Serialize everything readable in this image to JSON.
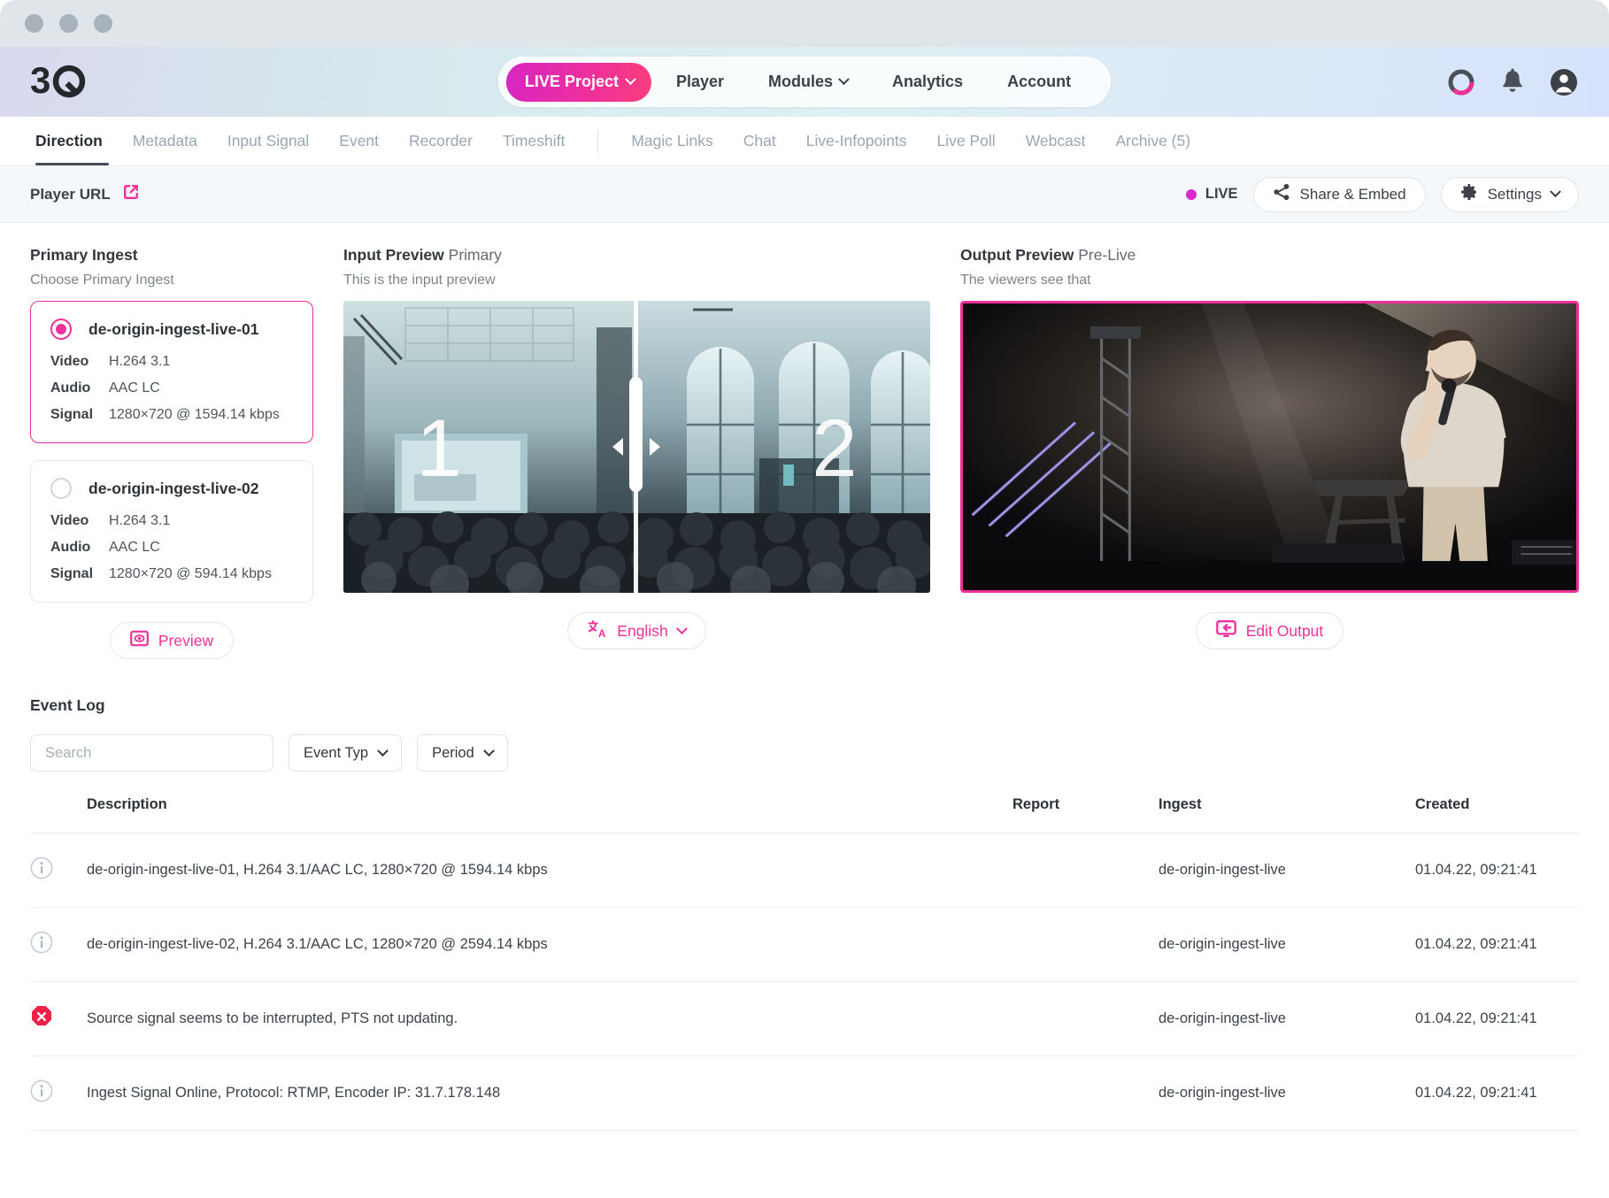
{
  "colors": {
    "accent": "#f0309a",
    "live": "#d92ad0",
    "error": "#ee2048",
    "text": "#3b4146"
  },
  "header": {
    "logo_text": "3Q",
    "project_button": "LIVE Project",
    "nav": [
      {
        "label": "Player",
        "caret": false
      },
      {
        "label": "Modules",
        "caret": true
      },
      {
        "label": "Analytics",
        "caret": false
      },
      {
        "label": "Account",
        "caret": false
      }
    ],
    "icons": [
      "ring-progress-icon",
      "bell-icon",
      "account-avatar-icon"
    ]
  },
  "tabs": [
    {
      "label": "Direction",
      "active": true
    },
    {
      "label": "Metadata",
      "active": false
    },
    {
      "label": "Input Signal",
      "active": false
    },
    {
      "label": "Event",
      "active": false
    },
    {
      "label": "Recorder",
      "active": false
    },
    {
      "label": "Timeshift",
      "active": false
    }
  ],
  "tabs2": [
    {
      "label": "Magic Links"
    },
    {
      "label": "Chat"
    },
    {
      "label": "Live-Infopoints"
    },
    {
      "label": "Live Poll"
    },
    {
      "label": "Webcast"
    },
    {
      "label": "Archive (5)"
    }
  ],
  "toolbar": {
    "player_url": "Player URL",
    "live_label": "LIVE",
    "share_label": "Share & Embed",
    "settings_label": "Settings"
  },
  "primary_ingest": {
    "title": "Primary Ingest",
    "subtitle": "Choose Primary Ingest",
    "preview_button": "Preview",
    "items": [
      {
        "name": "de-origin-ingest-live-01",
        "selected": true,
        "video_key": "Video",
        "video": "H.264 3.1",
        "audio_key": "Audio",
        "audio": "AAC LC",
        "signal_key": "Signal",
        "signal": "1280×720 @ 1594.14 kbps"
      },
      {
        "name": "de-origin-ingest-live-02",
        "selected": false,
        "video_key": "Video",
        "video": "H.264 3.1",
        "audio_key": "Audio",
        "audio": "AAC LC",
        "signal_key": "Signal",
        "signal": "1280×720 @ 594.14 kbps"
      }
    ]
  },
  "input_preview": {
    "title": "Input Preview",
    "badge": "Primary",
    "subtitle": "This is the input preview",
    "overlay_left": "1",
    "overlay_right": "2",
    "language_button": "English"
  },
  "output_preview": {
    "title": "Output Preview",
    "badge": "Pre-Live",
    "subtitle": "The viewers see that",
    "edit_button": "Edit Output"
  },
  "event_log": {
    "title": "Event Log",
    "search_placeholder": "Search",
    "search_value": "",
    "event_type_label": "Event Typ",
    "period_label": "Period",
    "columns": [
      "Description",
      "Report",
      "Ingest",
      "Created"
    ],
    "rows": [
      {
        "icon": "info-icon",
        "description": "de-origin-ingest-live-01, H.264 3.1/AAC LC, 1280×720 @ 1594.14 kbps",
        "report": "",
        "ingest": "de-origin-ingest-live",
        "created": "01.04.22, 09:21:41"
      },
      {
        "icon": "info-icon",
        "description": "de-origin-ingest-live-02, H.264 3.1/AAC LC, 1280×720 @ 2594.14 kbps",
        "report": "",
        "ingest": "de-origin-ingest-live",
        "created": "01.04.22, 09:21:41"
      },
      {
        "icon": "error-icon",
        "description": "Source signal seems to be interrupted, PTS not updating.",
        "report": "",
        "ingest": "de-origin-ingest-live",
        "created": "01.04.22, 09:21:41"
      },
      {
        "icon": "info-icon",
        "description": "Ingest Signal Online, Protocol: RTMP, Encoder IP: 31.7.178.148",
        "report": "",
        "ingest": "de-origin-ingest-live",
        "created": "01.04.22, 09:21:41"
      }
    ]
  }
}
